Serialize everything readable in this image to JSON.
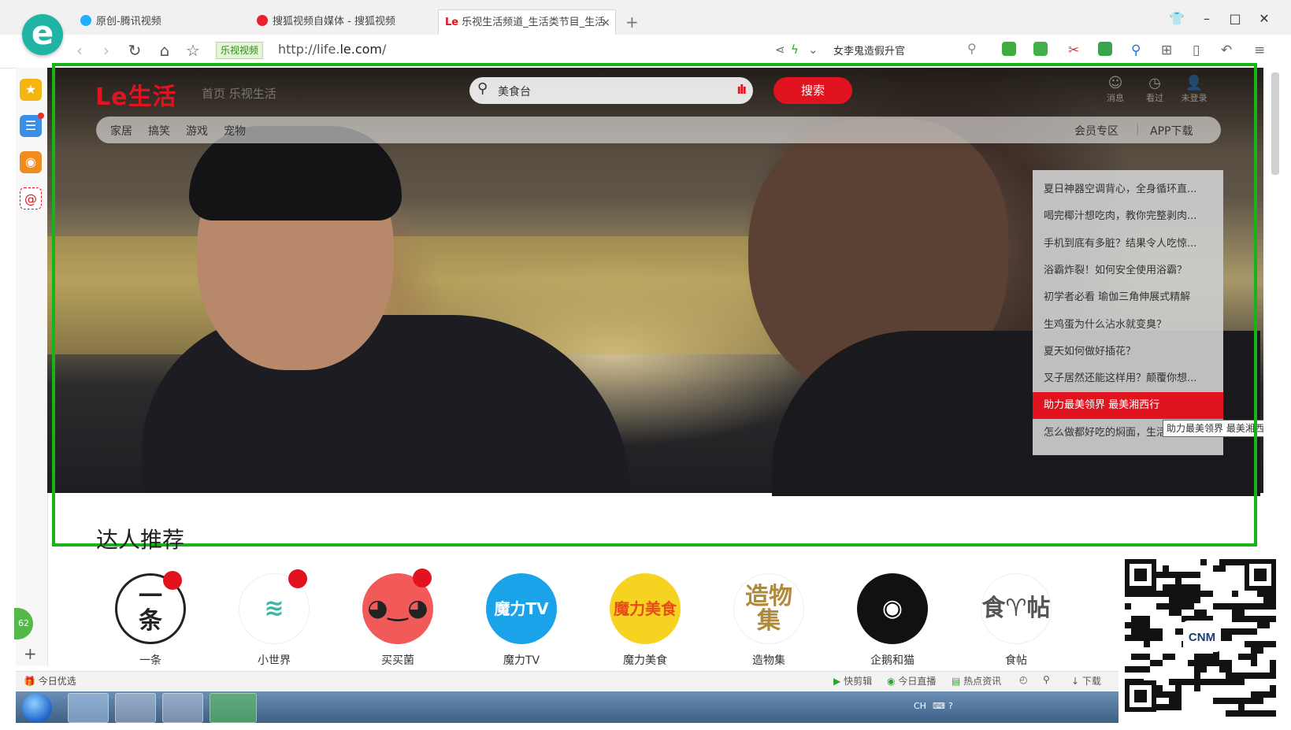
{
  "browser": {
    "tabs": [
      {
        "title": "原创-腾讯视频",
        "icon_color": "#1db0ff"
      },
      {
        "title": "搜狐视频自媒体 - 搜狐视频",
        "icon_color": "#e8232d"
      },
      {
        "title": "乐视生活频道_生活类节目_生活",
        "icon_color": "#e0131f",
        "favicon_text": "Le"
      }
    ],
    "new_tab": "+",
    "window_controls": {
      "restore": "❐",
      "minimize": "–",
      "maximize": "□",
      "close": "✕",
      "skin": "👕"
    },
    "site_badge": "乐视视频",
    "url_prefix": "http://life.",
    "url_domain": "le.com",
    "url_suffix": "/",
    "quick_search": "女李鬼造假升官"
  },
  "sidebar": {
    "green_badge": "62",
    "add": "+"
  },
  "site": {
    "logo": "Le生活",
    "faint_nav": "首页  乐视生活",
    "search": {
      "keyword": "美食台",
      "button": "搜索"
    },
    "top_icons": [
      {
        "glyph": "☺",
        "label": "消息"
      },
      {
        "glyph": "◷",
        "label": "看过"
      },
      {
        "glyph": "👤",
        "label": "未登录"
      }
    ],
    "categories": [
      "家居",
      "搞笑",
      "游戏",
      "宠物"
    ],
    "cat_right": [
      "会员专区",
      "APP下载"
    ],
    "hot_list": [
      "夏日神器空调背心，全身循环直...",
      "喝完椰汁想吃肉，教你完整剥肉...",
      "手机到底有多脏？结果令人吃惊...",
      "浴霸炸裂！如何安全使用浴霸？",
      "初学者必看 瑜伽三角伸展式精解",
      "生鸡蛋为什么沾水就变臭？",
      "夏天如何做好插花？",
      "叉子居然还能这样用？颠覆你想...",
      "助力最美领界 最美湘西行",
      "怎么做都好吃的焖面，生活大智慧"
    ],
    "hot_selected_index": 8,
    "tooltip": "助力最美领界 最美湘西行",
    "recommend_title": "达人推荐",
    "creators": [
      {
        "name": "一条",
        "avatar_text": "一\n条",
        "bg": "#ffffff",
        "fg": "#222222",
        "badge": true
      },
      {
        "name": "小世界",
        "avatar_text": "≋",
        "bg": "#ffffff",
        "fg": "#3cb6a8",
        "badge": true
      },
      {
        "name": "买买菌",
        "avatar_text": "◕‿◕",
        "bg": "#f25a5a",
        "fg": "#222222",
        "badge": true
      },
      {
        "name": "魔力TV",
        "avatar_text": "魔力TV",
        "bg": "#1aa3e8",
        "fg": "#ffffff",
        "badge": false
      },
      {
        "name": "魔力美食",
        "avatar_text": "魔力美食",
        "bg": "#f7d321",
        "fg": "#e84a1a",
        "badge": false
      },
      {
        "name": "造物集",
        "avatar_text": "造物集",
        "bg": "#ffffff",
        "fg": "#b08a3a",
        "badge": false
      },
      {
        "name": "企鹅和猫",
        "avatar_text": "◉",
        "bg": "#111111",
        "fg": "#ffffff",
        "badge": false
      },
      {
        "name": "食帖",
        "avatar_text": "食♈帖",
        "bg": "#ffffff",
        "fg": "#555555",
        "badge": false
      }
    ],
    "qr_center_text": "CNM"
  },
  "statusbar": {
    "left": "今日优选",
    "items": [
      "快剪辑",
      "今日直播",
      "热点资讯",
      "下载"
    ]
  },
  "taskbar": {
    "tray_lang": "CH"
  }
}
